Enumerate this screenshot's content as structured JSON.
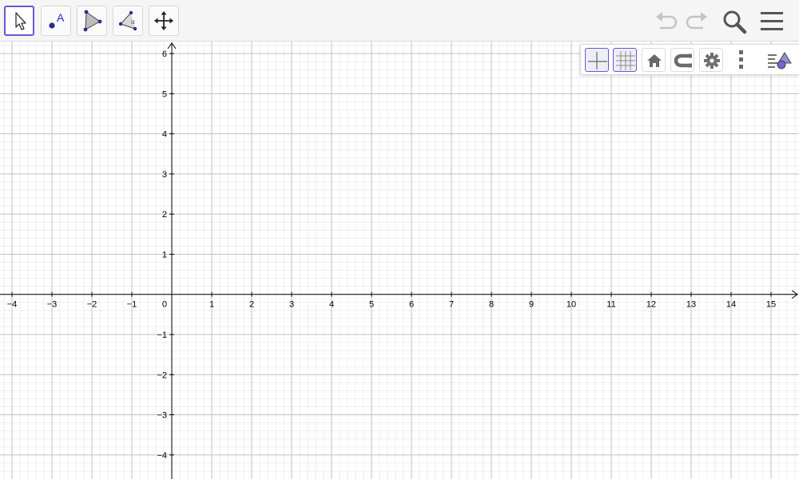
{
  "toolbar": {
    "tools": [
      {
        "name": "Move",
        "icon": "arrow-cursor-icon",
        "active": true
      },
      {
        "name": "Point",
        "icon": "point-icon",
        "glyph": "A"
      },
      {
        "name": "Polygon",
        "icon": "polygon-icon"
      },
      {
        "name": "Angle",
        "icon": "angle-icon",
        "glyph": "α"
      },
      {
        "name": "Move Graphics View",
        "icon": "move-view-icon"
      }
    ],
    "right_buttons": [
      "undo-icon",
      "redo-icon",
      "search-icon",
      "hamburger-menu-icon"
    ]
  },
  "style_bar": {
    "buttons": [
      {
        "icon": "axes-toggle-icon",
        "on": true
      },
      {
        "icon": "grid-toggle-icon",
        "on": true
      },
      {
        "icon": "home-icon",
        "on": false
      },
      {
        "icon": "magnet-icon",
        "on": false
      },
      {
        "icon": "gear-icon",
        "on": false
      },
      {
        "icon": "more-vertical-icon",
        "on": false
      },
      {
        "icon": "algebra-view-icon",
        "on": false
      }
    ]
  },
  "axes": {
    "x_min": -4.3,
    "x_max": 15.7,
    "y_min": -4.6,
    "y_max": 6.3,
    "x_ticks": [
      "−4",
      "−3",
      "−2",
      "−1",
      "1",
      "2",
      "3",
      "4",
      "5",
      "6",
      "7",
      "8",
      "9",
      "10",
      "11",
      "12",
      "13",
      "14",
      "15"
    ],
    "y_ticks": [
      "6",
      "5",
      "4",
      "3",
      "2",
      "1",
      "−1",
      "−2",
      "−3",
      "−4"
    ],
    "origin_label": "0",
    "major_grid": 1,
    "minor_grid": 0.2
  },
  "colors": {
    "accent": "#6557d2",
    "minor_grid": "#eeeeee",
    "major_grid": "#c0c0c0",
    "axis": "#000000"
  }
}
